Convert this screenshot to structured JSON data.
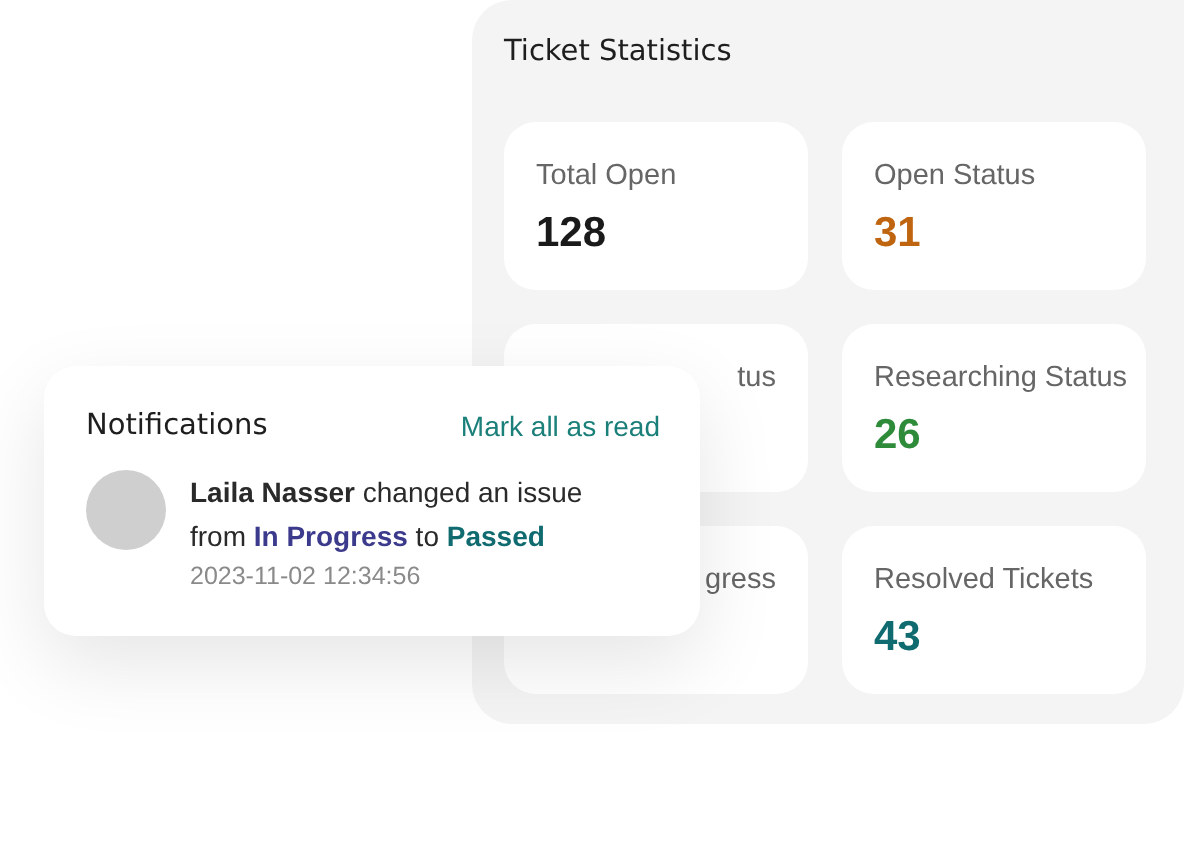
{
  "stats_panel": {
    "title": "Ticket Statistics",
    "cards": [
      {
        "label": "Total Open",
        "value": "128",
        "color": "#1a1a1a"
      },
      {
        "label": "Open Status",
        "value": "31",
        "color": "#c0650f"
      },
      {
        "label": "tus"
      },
      {
        "label": "Researching Status",
        "value": "26",
        "color": "#2e8b3a"
      },
      {
        "label": "gress"
      },
      {
        "label": "Resolved Tickets",
        "value": "43",
        "color": "#0f6b6f"
      }
    ]
  },
  "notifications": {
    "title": "Notifications",
    "mark_all_read": "Mark all as read",
    "items": [
      {
        "actor": "Laila Nasser",
        "text_1": "changed an issue from",
        "status_from": "In Progress",
        "text_2": "to",
        "status_to": "Passed",
        "time": "2023-11-02 12:34:56"
      }
    ]
  }
}
